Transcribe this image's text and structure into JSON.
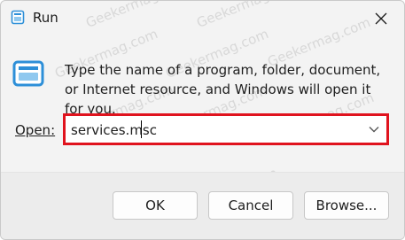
{
  "window": {
    "title": "Run",
    "message": "Type the name of a program, folder, document, or Internet resource, and Windows will open it for you."
  },
  "open": {
    "label": "Open:",
    "value": "services.msc"
  },
  "buttons": {
    "ok": "OK",
    "cancel": "Cancel",
    "browse": "Browse..."
  },
  "watermark": "Geekermag.com",
  "colors": {
    "highlight": "#e0131e",
    "accent": "#2d8fd8"
  },
  "icons": {
    "title": "run-icon",
    "close": "close-icon",
    "dropdown": "chevron-down-icon"
  }
}
